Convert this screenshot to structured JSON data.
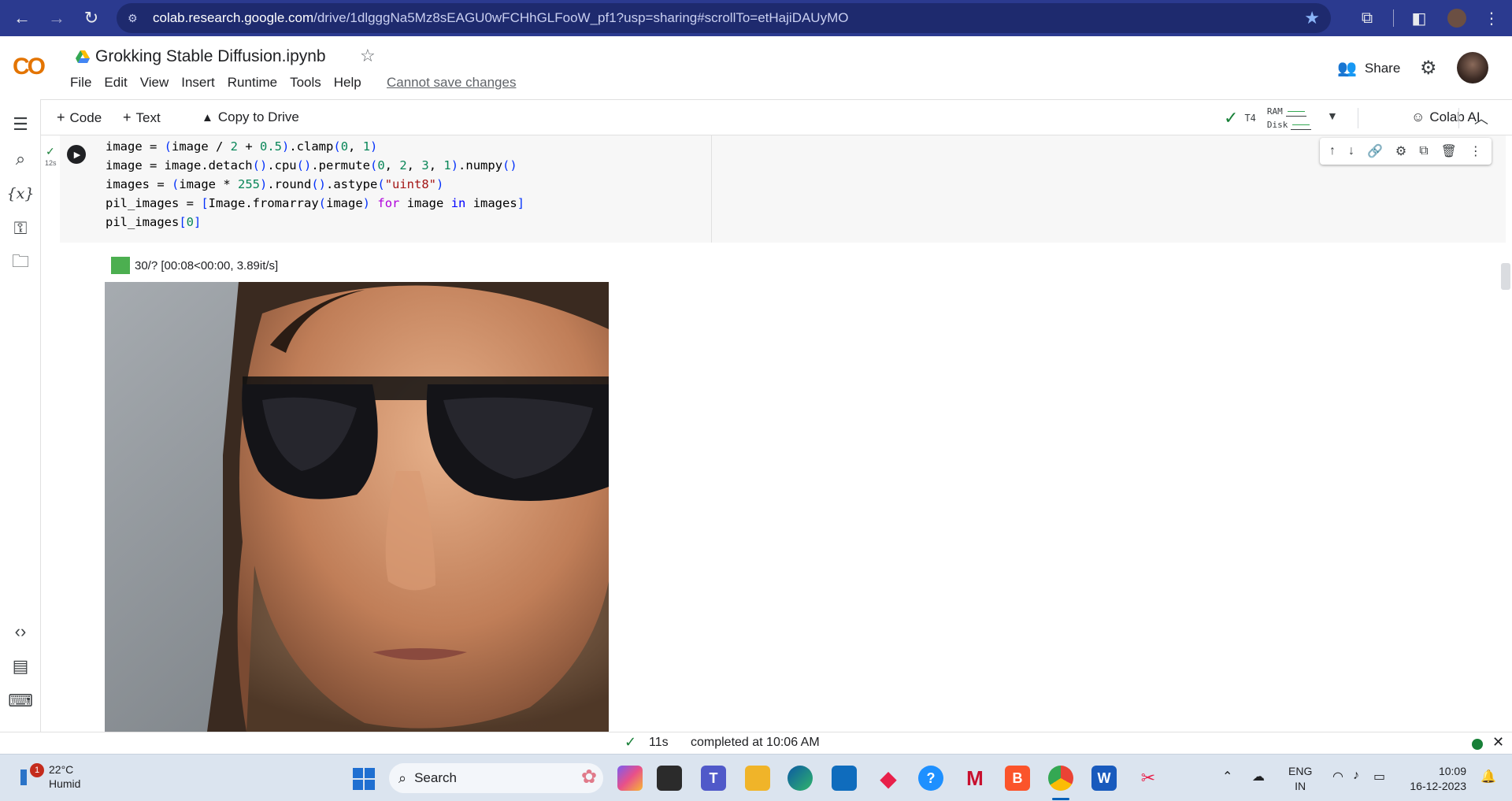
{
  "browser": {
    "url_host": "colab.research.google.com",
    "url_path": "/drive/1dlgggNa5Mz8sEAGU0wFCHhGLFooW_pf1?usp=sharing#scrollTo=etHajiDAUyMO"
  },
  "header": {
    "logo": "CO",
    "notebook_title": "Grokking Stable Diffusion.ipynb",
    "menu": [
      "File",
      "Edit",
      "View",
      "Insert",
      "Runtime",
      "Tools",
      "Help"
    ],
    "cannot_save": "Cannot save changes",
    "share_label": "Share"
  },
  "toolbar": {
    "code_label": "Code",
    "text_label": "Text",
    "copy_to_drive": "Copy to Drive",
    "runtime_type": "T4",
    "ram_label": "RAM",
    "disk_label": "Disk",
    "colab_ai": "Colab AI"
  },
  "cell": {
    "exec_time": "12s",
    "code_lines": [
      "image = (image / 2 + 0.5).clamp(0, 1)",
      "image = image.detach().cpu().permute(0, 2, 3, 1).numpy()",
      "images = (image * 255).round().astype(\"uint8\")",
      "pil_images = [Image.fromarray(image) for image in images]",
      "pil_images[0]"
    ]
  },
  "output": {
    "progress_text": "30/? [00:08<00:00, 3.89it/s]",
    "progress_fraction": 1.0
  },
  "status": {
    "duration": "11s",
    "message": "completed at 10:06 AM"
  },
  "taskbar": {
    "temperature": "22°C",
    "condition": "Humid",
    "notification_badge": "1",
    "search_label": "Search",
    "lang_line1": "ENG",
    "lang_line2": "IN",
    "time": "10:09",
    "date": "16-12-2023"
  },
  "colors": {
    "browser_bar": "#2b3a8f",
    "accent_green": "#188038",
    "progress_green": "#4caf50",
    "colab_orange": "#f9ab00"
  }
}
